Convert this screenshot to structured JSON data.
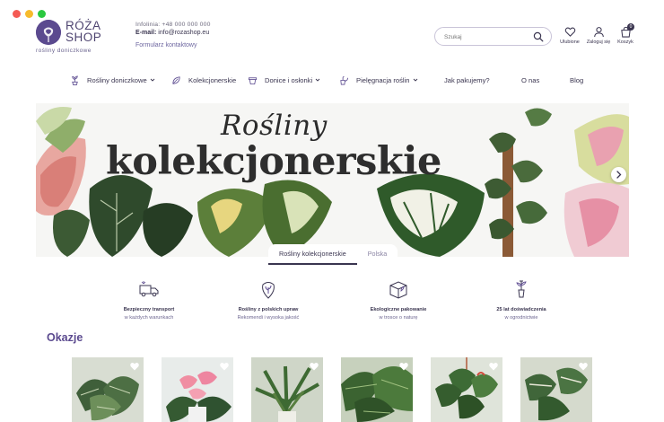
{
  "header": {
    "logo_line1": "RÓŻA",
    "logo_line2": "SHOP",
    "tagline": "rośliny doniczkowe",
    "contact_top": "Infolinia: +48 000 000 000",
    "email_label": "E-mail:",
    "email_value": "info@rozashop.eu",
    "contact_form": "Formularz kontaktowy",
    "search_placeholder": "Szukaj",
    "icons": [
      {
        "name": "heart-icon",
        "label": "Ulubione"
      },
      {
        "name": "user-icon",
        "label": "Zaloguj się"
      },
      {
        "name": "cart-icon",
        "label": "Koszyk"
      }
    ],
    "cart_count": "0"
  },
  "nav": [
    {
      "label": "Rośliny doniczkowe",
      "icon": "plant-icon",
      "dropdown": true
    },
    {
      "label": "Kolekcjonerskie",
      "icon": "leaf-icon",
      "dropdown": false
    },
    {
      "label": "Donice i osłonki",
      "icon": "pot-icon",
      "dropdown": true
    },
    {
      "label": "Pielęgnacja roślin",
      "icon": "care-icon",
      "dropdown": true
    },
    {
      "label": "Jak pakujemy?",
      "dropdown": false
    },
    {
      "label": "O nas",
      "dropdown": false
    },
    {
      "label": "Blog",
      "dropdown": false
    }
  ],
  "hero": {
    "script_text": "Rośliny",
    "title": "kolekcjonerskie",
    "tabs": [
      "Rośliny kolekcjonerskie",
      "Polska"
    ],
    "active_tab": 0
  },
  "features": [
    {
      "icon": "truck-icon",
      "title": "Bezpieczny transport",
      "subtitle": "w każdych warunkach"
    },
    {
      "icon": "plant-origin-icon",
      "title": "Rośliny z polskich upraw",
      "subtitle": "Rekomendi i wysoka jakość"
    },
    {
      "icon": "eco-box-icon",
      "title": "Ekologiczne pakowanie",
      "subtitle": "w trosce o naturę"
    },
    {
      "icon": "shovel-icon",
      "title": "25 lat doświadczenia",
      "subtitle": "w ogrodnictwie"
    }
  ],
  "section_title": "Okazje",
  "products_count_visible": 6,
  "colors": {
    "brand": "#5b4a8f",
    "text": "#3a3550",
    "muted": "#8a84a3"
  }
}
